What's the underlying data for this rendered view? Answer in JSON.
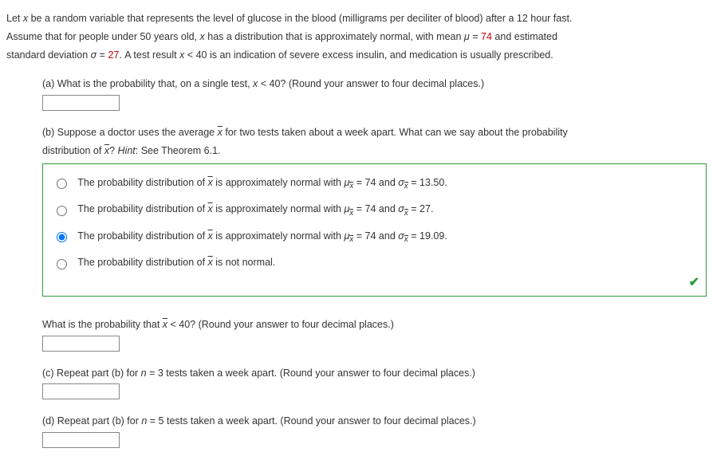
{
  "intro": {
    "line1_a": "Let ",
    "line1_var": "x",
    "line1_b": " be a random variable that represents the level of glucose in the blood (milligrams per deciliter of blood) after a 12 hour fast.",
    "line2_a": "Assume that for people under 50 years old, ",
    "line2_var": "x",
    "line2_b": " has a distribution that is approximately normal, with mean ",
    "mu_sym": "μ",
    "eq": " = ",
    "mu_val": "74",
    "line2_c": " and estimated",
    "line3_a": "standard deviation ",
    "sigma_sym": "σ",
    "sigma_val": "27",
    "line3_b": ". A test result ",
    "line3_var": "x",
    "line3_c": " < 40 is an indication of severe excess insulin, and medication is usually prescribed."
  },
  "a": {
    "label": "(a) What is the probability that, on a single test, ",
    "var": "x",
    "rest": " < 40? (Round your answer to four decimal places.)"
  },
  "b": {
    "line1_a": "(b) Suppose a doctor uses the average ",
    "xbar": "x",
    "line1_b": " for two tests taken about a week apart. What can we say about the probability",
    "line2_a": "distribution of ",
    "line2_b": "? ",
    "hint_label": "Hint",
    "hint_rest": ": See Theorem 6.1.",
    "opt_prefix": "The probability distribution of ",
    "opt_mid": " is approximately normal with ",
    "mu_expr": " = 74 and ",
    "opt1_sigma": " = 13.50.",
    "opt2_sigma": " = 27.",
    "opt3_sigma": " = 19.09.",
    "opt4_a": "The probability distribution of ",
    "opt4_b": " is not normal."
  },
  "b2": {
    "label_a": "What is the probability that ",
    "xbar": "x",
    "label_b": " < 40? (Round your answer to four decimal places.)"
  },
  "c": {
    "text_a": "(c) Repeat part (b) for ",
    "nvar": "n",
    "text_b": " = 3 tests taken a week apart. (Round your answer to four decimal places.)"
  },
  "d": {
    "text_a": "(d) Repeat part (b) for ",
    "nvar": "n",
    "text_b": " = 5 tests taken a week apart. (Round your answer to four decimal places.)"
  }
}
